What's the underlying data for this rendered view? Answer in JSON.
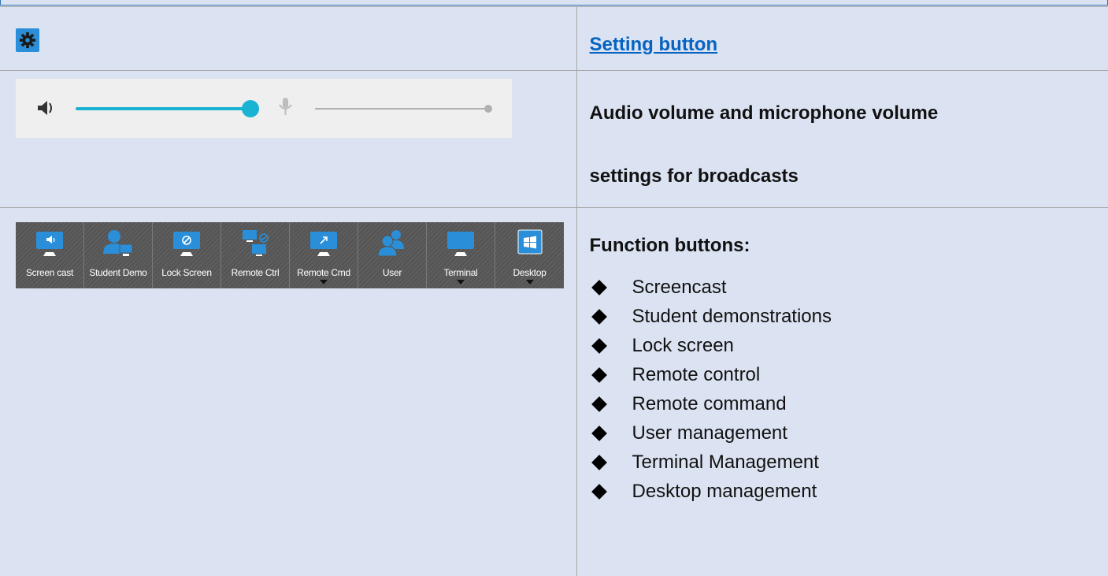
{
  "row1": {
    "setting_link": "Setting button",
    "gear_icon": "gear-icon",
    "accent": "#2a8fd8"
  },
  "row2": {
    "audio": {
      "speaker_icon": "speaker-icon",
      "mic_icon": "microphone-icon",
      "audio_level": 1.0,
      "mic_level": 1.0,
      "slider_color": "#1bb3d3"
    },
    "description_line1": "Audio volume and microphone volume",
    "description_line2": "settings for broadcasts"
  },
  "row3": {
    "toolbar": [
      {
        "label": "Screen cast",
        "icon": "screencast-icon",
        "dropdown": false
      },
      {
        "label": "Student Demo",
        "icon": "student-demo-icon",
        "dropdown": false
      },
      {
        "label": "Lock Screen",
        "icon": "lock-screen-icon",
        "dropdown": false
      },
      {
        "label": "Remote Ctrl",
        "icon": "remote-control-icon",
        "dropdown": false
      },
      {
        "label": "Remote Cmd",
        "icon": "remote-command-icon",
        "dropdown": true
      },
      {
        "label": "User",
        "icon": "user-icon",
        "dropdown": false
      },
      {
        "label": "Terminal",
        "icon": "terminal-icon",
        "dropdown": true
      },
      {
        "label": "Desktop",
        "icon": "desktop-icon",
        "dropdown": true
      }
    ],
    "heading": "Function buttons:",
    "functions": [
      "Screencast",
      "Student demonstrations",
      "Lock screen",
      "Remote control",
      "Remote command",
      "User management",
      "Terminal Management",
      "Desktop management"
    ]
  }
}
